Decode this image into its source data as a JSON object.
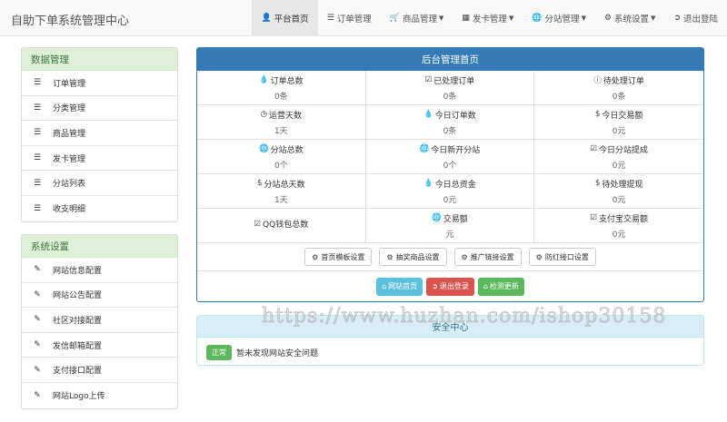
{
  "brand": "自助下单系统管理中心",
  "nav": [
    {
      "label": "平台首页",
      "icon": "user-icon",
      "active": true
    },
    {
      "label": "订单管理",
      "icon": "list-icon"
    },
    {
      "label": "商品管理",
      "icon": "cart-icon",
      "dropdown": true
    },
    {
      "label": "发卡管理",
      "icon": "grid-icon",
      "dropdown": true
    },
    {
      "label": "分站管理",
      "icon": "globe-icon",
      "dropdown": true
    },
    {
      "label": "系统设置",
      "icon": "gear-icon",
      "dropdown": true
    },
    {
      "label": "退出登陆",
      "icon": "logout-icon"
    }
  ],
  "sidebar": {
    "data_title": "数据管理",
    "data_items": [
      "订单管理",
      "分类管理",
      "商品管理",
      "发卡管理",
      "分站列表",
      "收支明细"
    ],
    "sys_title": "系统设置",
    "sys_items": [
      "网站信息配置",
      "网站公告配置",
      "社区对接配置",
      "发信邮箱配置",
      "支付接口配置",
      "网站Logo上传"
    ]
  },
  "main": {
    "title": "后台管理首页",
    "stats": [
      {
        "label": "订单总数",
        "value": "0条",
        "icon": "drop-icon"
      },
      {
        "label": "已处理订单",
        "value": "0条",
        "icon": "check-icon"
      },
      {
        "label": "待处理订单",
        "value": "0条",
        "icon": "info-icon"
      },
      {
        "label": "运营天数",
        "value": "1天",
        "icon": "clock-icon"
      },
      {
        "label": "今日订单数",
        "value": "0条",
        "icon": "drop-icon"
      },
      {
        "label": "今日交易额",
        "value": "0元",
        "icon": "dollar-icon"
      },
      {
        "label": "分站总数",
        "value": "0个",
        "icon": "globe-icon"
      },
      {
        "label": "今日新开分站",
        "value": "0个",
        "icon": "globe-icon"
      },
      {
        "label": "今日分站提成",
        "value": "0元",
        "icon": "check-icon"
      },
      {
        "label": "分站总天数",
        "value": "1天",
        "icon": "dollar-icon"
      },
      {
        "label": "今日总资金",
        "value": "0元",
        "icon": "drop-icon"
      },
      {
        "label": "待处理提现",
        "value": "0元",
        "icon": "dollar-icon"
      },
      {
        "label": "QQ钱包总数",
        "value": "",
        "icon": "check-icon"
      },
      {
        "label": "交易额",
        "value": "元",
        "icon": "globe-icon"
      },
      {
        "label": "支付宝交易额",
        "value": "0元",
        "icon": "check-icon"
      }
    ],
    "buttons": [
      "首页模板设置",
      "抽奖商品设置",
      "推广链接设置",
      "防红接口设置"
    ],
    "action_buttons": [
      {
        "label": "网站首页",
        "color": "#5bc0de",
        "icon": "home-icon"
      },
      {
        "label": "退出登录",
        "color": "#d9534f",
        "icon": "logout-icon"
      },
      {
        "label": "检测更新",
        "color": "#5cb85c",
        "icon": "home-icon"
      }
    ]
  },
  "security": {
    "title": "安全中心",
    "badge": "正常",
    "message": "暂未发现网站安全问题"
  },
  "watermark": "https://www.huzhan.com/ishop30158"
}
